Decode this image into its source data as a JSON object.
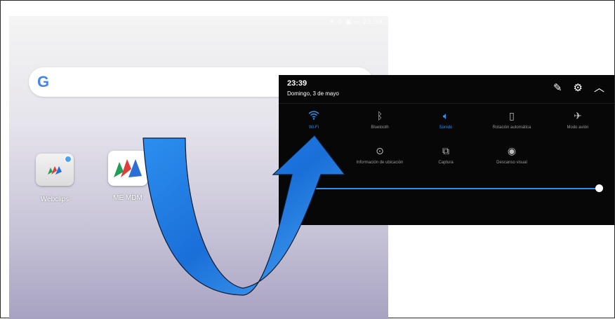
{
  "status_bar": {
    "text": "⁕ ⊙ ▣ ▭ 23:39"
  },
  "search": {
    "logo": "G"
  },
  "apps": [
    {
      "label": "Webclips",
      "icon": "folder-icon"
    },
    {
      "label": "ME MDM",
      "icon": "me-mdm-icon"
    }
  ],
  "quick_settings": {
    "time": "23:39",
    "date": "Domingo, 3 de mayo",
    "header_icons": [
      "edit-icon",
      "gear-icon",
      "chevron-up-icon"
    ],
    "tiles": [
      {
        "label": "Wi-Fi",
        "icon": "wifi-icon",
        "active": true
      },
      {
        "label": "Bluetooth",
        "icon": "bluetooth-icon",
        "active": false
      },
      {
        "label": "Sonido",
        "icon": "sound-icon",
        "active": true
      },
      {
        "label": "Rotación automática",
        "icon": "rotation-icon",
        "active": false
      },
      {
        "label": "Modo avión",
        "icon": "airplane-icon",
        "active": false
      },
      {
        "label": "Información de ubicación",
        "icon": "location-icon",
        "active": false
      },
      {
        "label": "Captura",
        "icon": "screenshot-icon",
        "active": false
      },
      {
        "label": "Descanso visual",
        "icon": "eye-icon",
        "active": false
      }
    ],
    "brightness": 1.0
  },
  "colors": {
    "accent": "#2f8ef0",
    "arrow_fill": "#1f7fe6",
    "panel_bg": "#070707"
  }
}
